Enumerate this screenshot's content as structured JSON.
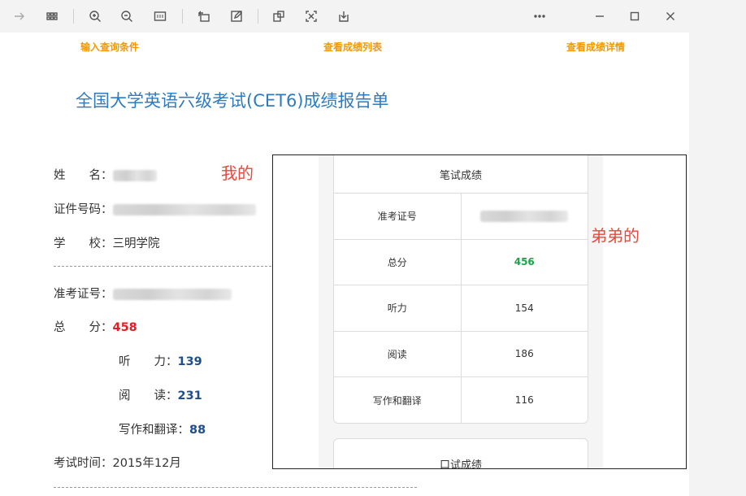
{
  "steps": {
    "step1": "输入查询条件",
    "step2": "查看成绩列表",
    "step3": "查看成绩详情"
  },
  "report_title": "全国大学英语六级考试(CET6)成绩报告单",
  "mine": {
    "name_label": "姓　　名：",
    "id_label": "证件号码：",
    "school_label": "学　　校：",
    "school": "三明学院",
    "ticket_label": "准考证号：",
    "total_label": "总　　分：",
    "total": "458",
    "listening_label": "听　　力：",
    "listening": "139",
    "reading_label": "阅　　读：",
    "reading": "231",
    "writing_label": "写作和翻译：",
    "writing": "88",
    "exam_time_label": "考试时间：",
    "exam_time": "2015年12月"
  },
  "notes": {
    "mine": "我的",
    "brother": "弟弟的"
  },
  "brother": {
    "written_header": "笔试成绩",
    "ticket_label": "准考证号",
    "total_label": "总分",
    "total": "456",
    "listening_label": "听力",
    "listening": "154",
    "reading_label": "阅读",
    "reading": "186",
    "writing_label": "写作和翻译",
    "writing": "116",
    "oral_header": "口试成绩"
  },
  "colors": {
    "steps": "#f39800",
    "title": "#2e7bbf",
    "total_red": "#e51c23",
    "score_blue": "#1f4e8c",
    "total_green": "#1aa34a",
    "note_red": "#e8473b"
  },
  "icons": {
    "forward": "arrow-right-icon",
    "apps": "grid-icon",
    "zoom_in": "zoom-in-icon",
    "zoom_out": "zoom-out-icon",
    "fit": "fit-page-icon",
    "rotate": "rotate-icon",
    "edit": "edit-icon",
    "crop": "crop-icon",
    "scan": "scan-icon",
    "save": "save-icon",
    "more": "more-icon",
    "minimize": "minimize-icon",
    "maximize": "maximize-icon",
    "close": "close-icon"
  }
}
